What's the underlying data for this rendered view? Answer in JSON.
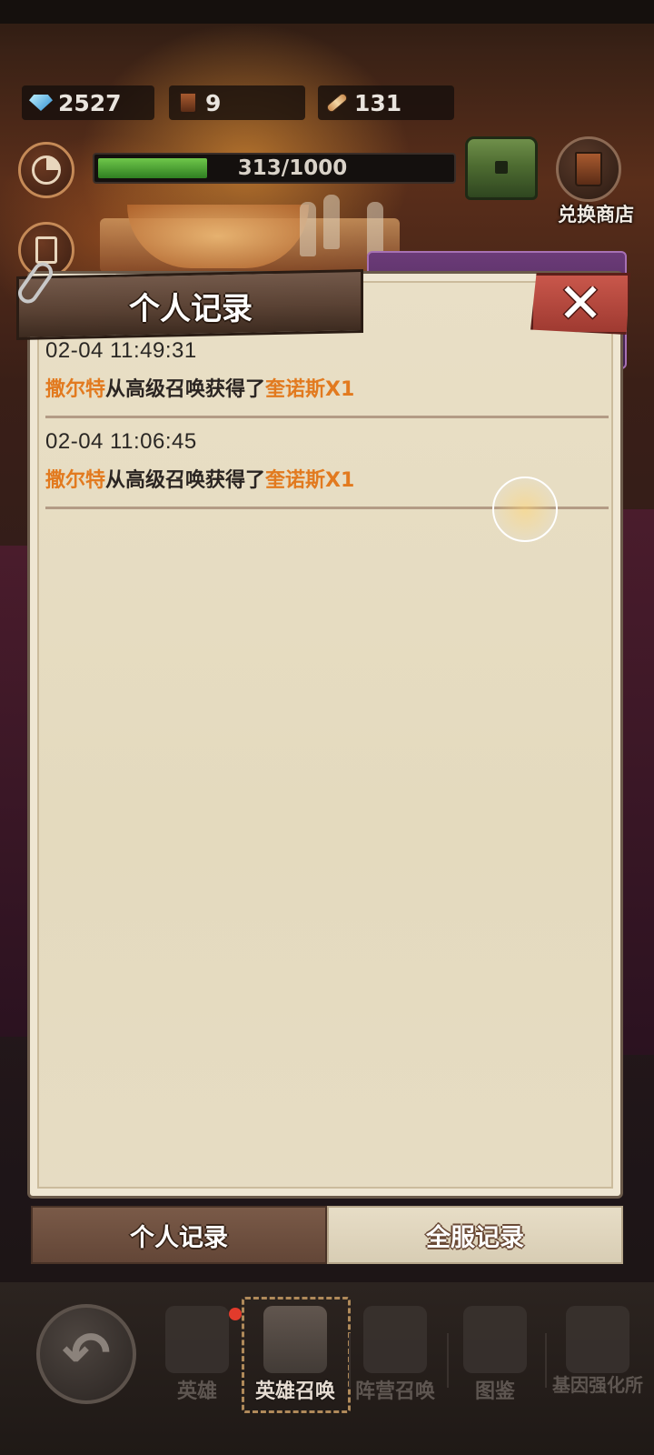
{
  "resources": [
    {
      "icon": "gem-icon",
      "value": "2527"
    },
    {
      "icon": "beer-mug-icon",
      "value": "9"
    },
    {
      "icon": "scroll-icon",
      "value": "131"
    }
  ],
  "progress": {
    "text": "313/1000",
    "value": 313,
    "max": 1000
  },
  "shop": {
    "label": "兑换商店"
  },
  "dialog": {
    "title": "个人记录",
    "close_label": "✕",
    "records": [
      {
        "time": "02-04  11:49:31",
        "player": "撒尔特",
        "middle": "从高级召唤获得了",
        "item": "奎诺斯X1"
      },
      {
        "time": "02-04  11:06:45",
        "player": "撒尔特",
        "middle": "从高级召唤获得了",
        "item": "奎诺斯X1"
      }
    ],
    "tabs": [
      {
        "label": "个人记录",
        "active": true
      },
      {
        "label": "全服记录",
        "active": false
      }
    ]
  },
  "bottom_nav": {
    "back_icon": "back-arrow-icon",
    "items": [
      {
        "label": "英雄",
        "active": false
      },
      {
        "label": "英雄召唤",
        "active": true
      },
      {
        "label": "阵营召唤",
        "active": false
      },
      {
        "label": "图鉴",
        "active": false
      },
      {
        "label": "基因强化所",
        "active": false
      }
    ]
  },
  "colors": {
    "highlight": "#e27a1f",
    "tab_active": "#634637",
    "dialog_bg": "#e6dcc3"
  }
}
